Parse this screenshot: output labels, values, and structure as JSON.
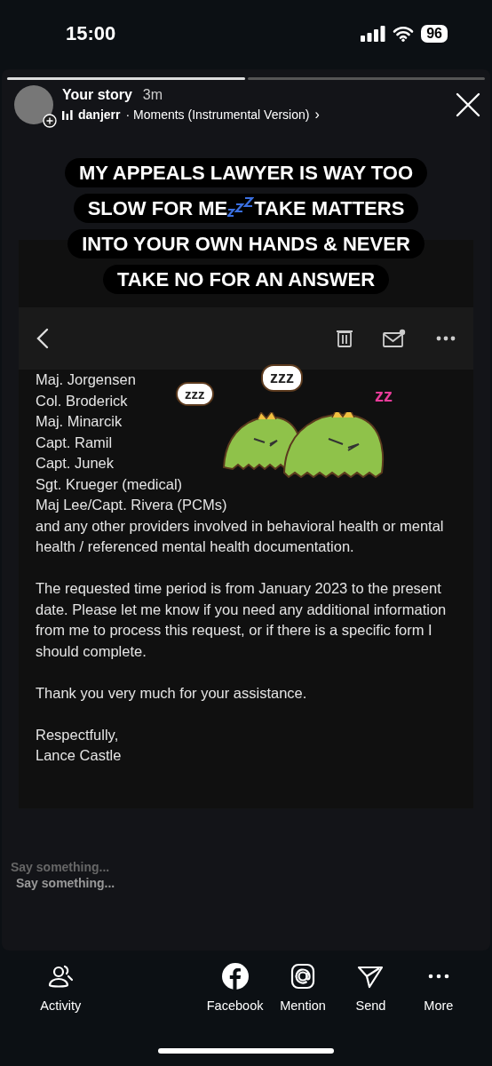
{
  "status_bar": {
    "time": "15:00",
    "battery": "96"
  },
  "story": {
    "progress": [
      {
        "level": 1
      },
      {
        "level": 0
      }
    ],
    "title": "Your story",
    "age": "3m",
    "artist": "danjerr",
    "song": "· Moments (Instrumental Version)",
    "chevron": "›"
  },
  "caption": {
    "before": "MY APPEALS LAWYER IS WAY TOO SLOW FOR ME",
    "after": "TAKE MATTERS INTO YOUR OWN HANDS & NEVER TAKE NO FOR AN ANSWER"
  },
  "sticker": {
    "bubbles": [
      "zzz",
      "zzz"
    ],
    "snore": "zz"
  },
  "email": {
    "blocks": [
      [
        "Maj. Jorgensen",
        "Col. Broderick",
        "Maj. Minarcik",
        "Capt. Ramil",
        "Capt. Junek",
        "Sgt. Krueger (medical)",
        "Maj Lee/Capt. Rivera (PCMs)",
        "and any other providers involved in behavioral health or mental health / referenced mental health documentation."
      ],
      [
        "The requested time period is from January 2023 to the present date. Please let me know if you need any additional information from me to process this request, or if there is a specific form I should complete."
      ],
      [
        "Thank you very much for your assistance."
      ],
      [
        "Respectfully,",
        "Lance Castle"
      ]
    ]
  },
  "reply": {
    "placeholder": "Say something...",
    "placeholder_echo": "Say something..."
  },
  "actions": [
    {
      "kind": "activity",
      "label": "Activity"
    },
    {
      "kind": "facebook",
      "label": "Facebook"
    },
    {
      "kind": "mention",
      "label": "Mention"
    },
    {
      "kind": "send",
      "label": "Send"
    },
    {
      "kind": "more",
      "label": "More"
    }
  ]
}
